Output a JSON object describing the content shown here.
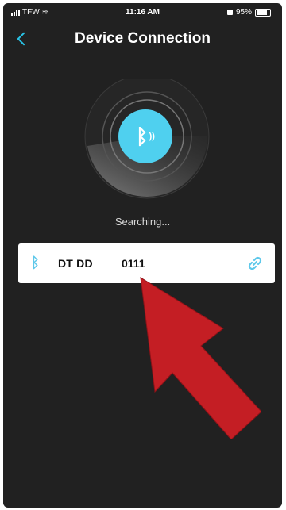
{
  "status_bar": {
    "carrier": "TFW",
    "time": "11:16 AM",
    "battery": "95%"
  },
  "header": {
    "title": "Device Connection",
    "back_icon": "chevron-left-icon"
  },
  "search": {
    "status": "Searching..."
  },
  "device": {
    "name": "DT DD",
    "id": "0111",
    "icon": "bluetooth-icon",
    "action_icon": "link-icon"
  },
  "colors": {
    "background": "#212121",
    "accent": "#4fd0ef",
    "card": "#ffffff",
    "arrow": "#c41e24"
  }
}
